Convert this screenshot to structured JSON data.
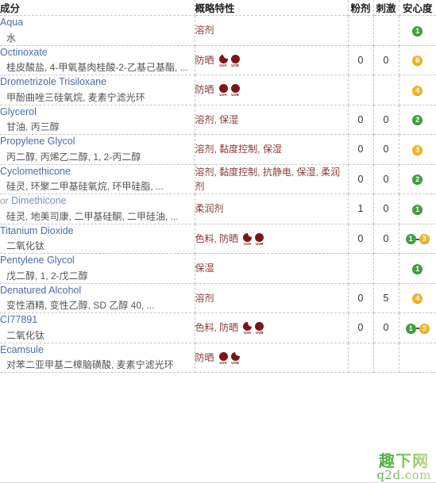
{
  "table": {
    "headers": {
      "ingredient": "成分",
      "properties": "概略特性",
      "powder": "粉剂",
      "irritation": "刺激",
      "safety": "安心度"
    },
    "rows": [
      {
        "prefix": "",
        "name_en": "Aqua",
        "name_cn": "水",
        "properties": "溶剂",
        "uv": [],
        "powder": "",
        "irritation": "",
        "safety": [
          {
            "value": "1",
            "color": "green"
          }
        ]
      },
      {
        "prefix": "",
        "name_en": "Octinoxate",
        "name_cn": "桂皮酸盐, 4-甲氧基肉桂酸-2-乙基己基酯, ...",
        "properties": "防晒",
        "uv": [
          {
            "label": "UVA",
            "fill": "partial"
          },
          {
            "label": "UVB",
            "fill": "full"
          }
        ],
        "powder": "0",
        "irritation": "0",
        "safety": [
          {
            "value": "6",
            "color": "orange"
          }
        ]
      },
      {
        "prefix": "",
        "name_en": "Drometrizole Trisiloxane",
        "name_cn": "甲酚曲唑三硅氧烷, 麦素宁滤光环",
        "properties": "防晒",
        "uv": [
          {
            "label": "UVA",
            "fill": "full"
          },
          {
            "label": "UVB",
            "fill": "full"
          }
        ],
        "powder": "",
        "irritation": "",
        "safety": [
          {
            "value": "4",
            "color": "orange"
          }
        ]
      },
      {
        "prefix": "",
        "name_en": "Glycerol",
        "name_cn": "甘油, 丙三醇",
        "properties": "溶剂, 保湿",
        "uv": [],
        "powder": "0",
        "irritation": "0",
        "safety": [
          {
            "value": "2",
            "color": "green"
          }
        ]
      },
      {
        "prefix": "",
        "name_en": "Propylene Glycol",
        "name_cn": "丙二醇, 丙烯乙二醇, 1, 2-丙二醇",
        "properties": "溶剂, 黏度控制, 保湿",
        "uv": [],
        "powder": "0",
        "irritation": "0",
        "safety": [
          {
            "value": "3",
            "color": "orange"
          }
        ]
      },
      {
        "prefix": "",
        "name_en": "Cyclomethicone",
        "name_cn": "硅灵, 环聚二甲基硅氧烷, 环甲硅脂, ...",
        "properties": "溶剂, 黏度控制, 抗静电, 保湿, 柔润剂",
        "uv": [],
        "powder": "0",
        "irritation": "0",
        "safety": [
          {
            "value": "2",
            "color": "green"
          }
        ]
      },
      {
        "prefix": "or",
        "name_en": "Dimethicone",
        "name_cn": "硅灵, 地美司康, 二甲基硅酮, 二甲硅油, ...",
        "properties": "柔润剂",
        "uv": [],
        "powder": "1",
        "irritation": "0",
        "safety": [
          {
            "value": "1",
            "color": "green"
          }
        ]
      },
      {
        "prefix": "",
        "name_en": "Titanium Dioxide",
        "name_cn": "二氧化钛",
        "properties": "色料, 防晒",
        "uv": [
          {
            "label": "UVA",
            "fill": "partial"
          },
          {
            "label": "UVB",
            "fill": "full"
          }
        ],
        "powder": "0",
        "irritation": "0",
        "safety": [
          {
            "value": "1",
            "color": "green"
          },
          {
            "value": "3",
            "color": "orange"
          }
        ]
      },
      {
        "prefix": "",
        "name_en": "Pentylene Glycol",
        "name_cn": "戊二醇, 1, 2-戊二醇",
        "properties": "保湿",
        "uv": [],
        "powder": "",
        "irritation": "",
        "safety": [
          {
            "value": "1",
            "color": "green"
          }
        ]
      },
      {
        "prefix": "",
        "name_en": "Denatured Alcohol",
        "name_cn": "变性酒精, 变性乙醇, SD 乙醇 40, ...",
        "properties": "溶剂",
        "uv": [],
        "powder": "0",
        "irritation": "5",
        "safety": [
          {
            "value": "4",
            "color": "orange"
          }
        ]
      },
      {
        "prefix": "",
        "name_en": "CI77891",
        "name_cn": "二氧化钛",
        "properties": "色料, 防晒",
        "uv": [
          {
            "label": "UVA",
            "fill": "partial"
          },
          {
            "label": "UVB",
            "fill": "full"
          }
        ],
        "powder": "0",
        "irritation": "0",
        "safety": [
          {
            "value": "1",
            "color": "green"
          },
          {
            "value": "3",
            "color": "orange"
          }
        ]
      },
      {
        "prefix": "",
        "name_en": "Ecamsule",
        "name_cn": "对苯二亚甲基二樟脑磺酸, 麦素宁滤光环",
        "properties": "防晒",
        "uv": [
          {
            "label": "UVA",
            "fill": "full"
          },
          {
            "label": "UVB",
            "fill": "partial"
          }
        ],
        "powder": "",
        "irritation": "",
        "safety": []
      }
    ]
  },
  "watermark": {
    "cn": "趣下网",
    "en": "q2d.com"
  },
  "colors": {
    "link": "#4a6ea9",
    "property": "#8a3a3a",
    "uv": "#7d1516",
    "badge_green": "#3fa23c",
    "badge_orange": "#f5b326"
  }
}
